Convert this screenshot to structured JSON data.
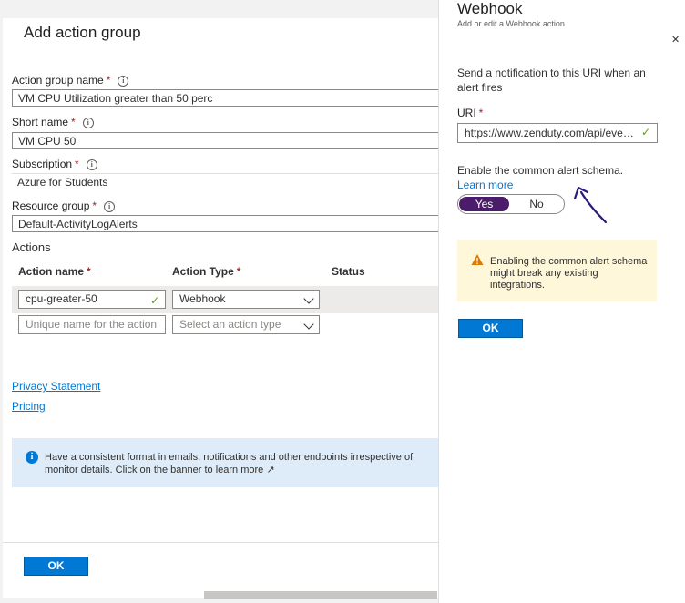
{
  "left_blade": {
    "title": "Add action group",
    "fields": [
      {
        "label": "Action group name",
        "value": "VM CPU Utilization greater than 50 perc"
      },
      {
        "label": "Short name",
        "value": "VM CPU 50"
      },
      {
        "label": "Subscription",
        "value": "Azure for Students"
      },
      {
        "label": "Resource group",
        "value": "Default-ActivityLogAlerts"
      }
    ],
    "required_mark": "*",
    "info_glyph": "i",
    "actions": {
      "heading": "Actions",
      "columns": {
        "name": "Action name",
        "type": "Action Type",
        "status": "Status"
      },
      "rows": [
        {
          "name": "cpu-greater-50",
          "type": "Webhook",
          "status": ""
        }
      ],
      "new_row": {
        "name_placeholder": "Unique name for the action",
        "type_placeholder": "Select an action type"
      }
    },
    "links": {
      "privacy": "Privacy Statement",
      "pricing": "Pricing"
    },
    "banner_text": "Have a consistent format in emails, notifications and other endpoints irrespective of monitor details. Click on the banner to learn more",
    "ok_label": "OK"
  },
  "webhook_panel": {
    "title": "Webhook",
    "subtitle": "Add or edit a Webhook action",
    "description": "Send a notification to this URI when an alert fires",
    "uri_label": "URI",
    "uri_value": "https://www.zenduty.com/api/events/",
    "schema_text": "Enable the common alert schema.",
    "schema_link": "Learn more",
    "toggle": {
      "yes": "Yes",
      "no": "No",
      "selected": "Yes"
    },
    "warning_text": "Enabling the common alert schema might break any existing integrations.",
    "ok_label": "OK"
  },
  "colors": {
    "accent": "#0078d4",
    "toggle_on": "#4b1c69",
    "warning_bg": "#fff4ce",
    "annotation": "#2b1a78"
  }
}
